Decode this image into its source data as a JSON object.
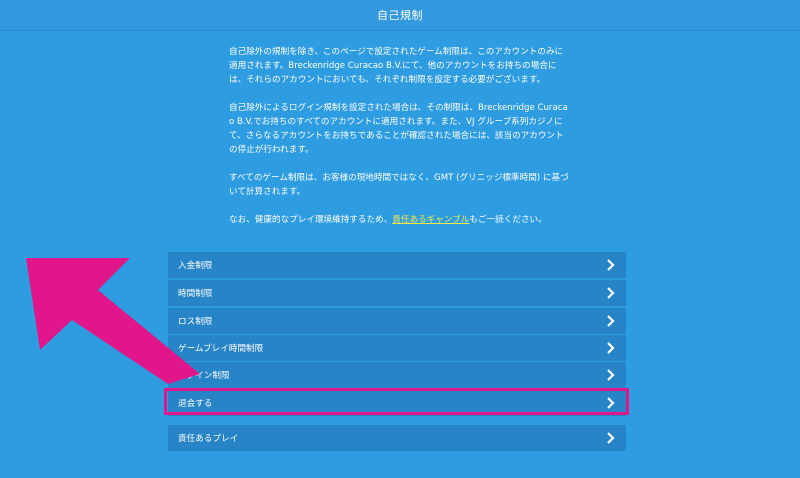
{
  "header": {
    "title": "自己規制"
  },
  "intro": {
    "p1": "自己除外の規制を除き、このページで設定されたゲーム制限は、このアカウントのみに適用されます。Breckenridge Curacao B.V.にて、他のアカウントをお持ちの場合には、それらのアカウントにおいても、それぞれ制限を設定する必要がございます。",
    "p2": "自己除外によるログイン規制を設定された場合は、その制限は、Breckenridge Curacao B.V.でお持ちのすべてのアカウントに適用されます。また、VJ グループ系列カジノにて、さらなるアカウントをお持ちであることが確認された場合には、該当のアカウントの停止が行われます。",
    "p3": "すべてのゲーム制限は、お客様の現地時間ではなく、GMT (グリニッジ標準時間) に基づいて計算されます。",
    "p4_prefix": "なお、健康的なプレイ環境維持するため、",
    "p4_link": "責任あるギャンブル",
    "p4_suffix": "もご一読ください。"
  },
  "menu": {
    "items": [
      {
        "label": "入金制限"
      },
      {
        "label": "時間制限"
      },
      {
        "label": "ロス制限"
      },
      {
        "label": "ゲームプレイ時間制限"
      },
      {
        "label": "ログイン制限"
      },
      {
        "label": "退会する"
      },
      {
        "label": "責任あるプレイ"
      }
    ]
  },
  "icons": {
    "chevron": "chevron-right-icon",
    "pointer": "arrow-pointer"
  },
  "colors": {
    "background": "#2e9ce1",
    "row": "#2784c7",
    "highlight": "#e0168a",
    "link": "#f3ea4a"
  }
}
